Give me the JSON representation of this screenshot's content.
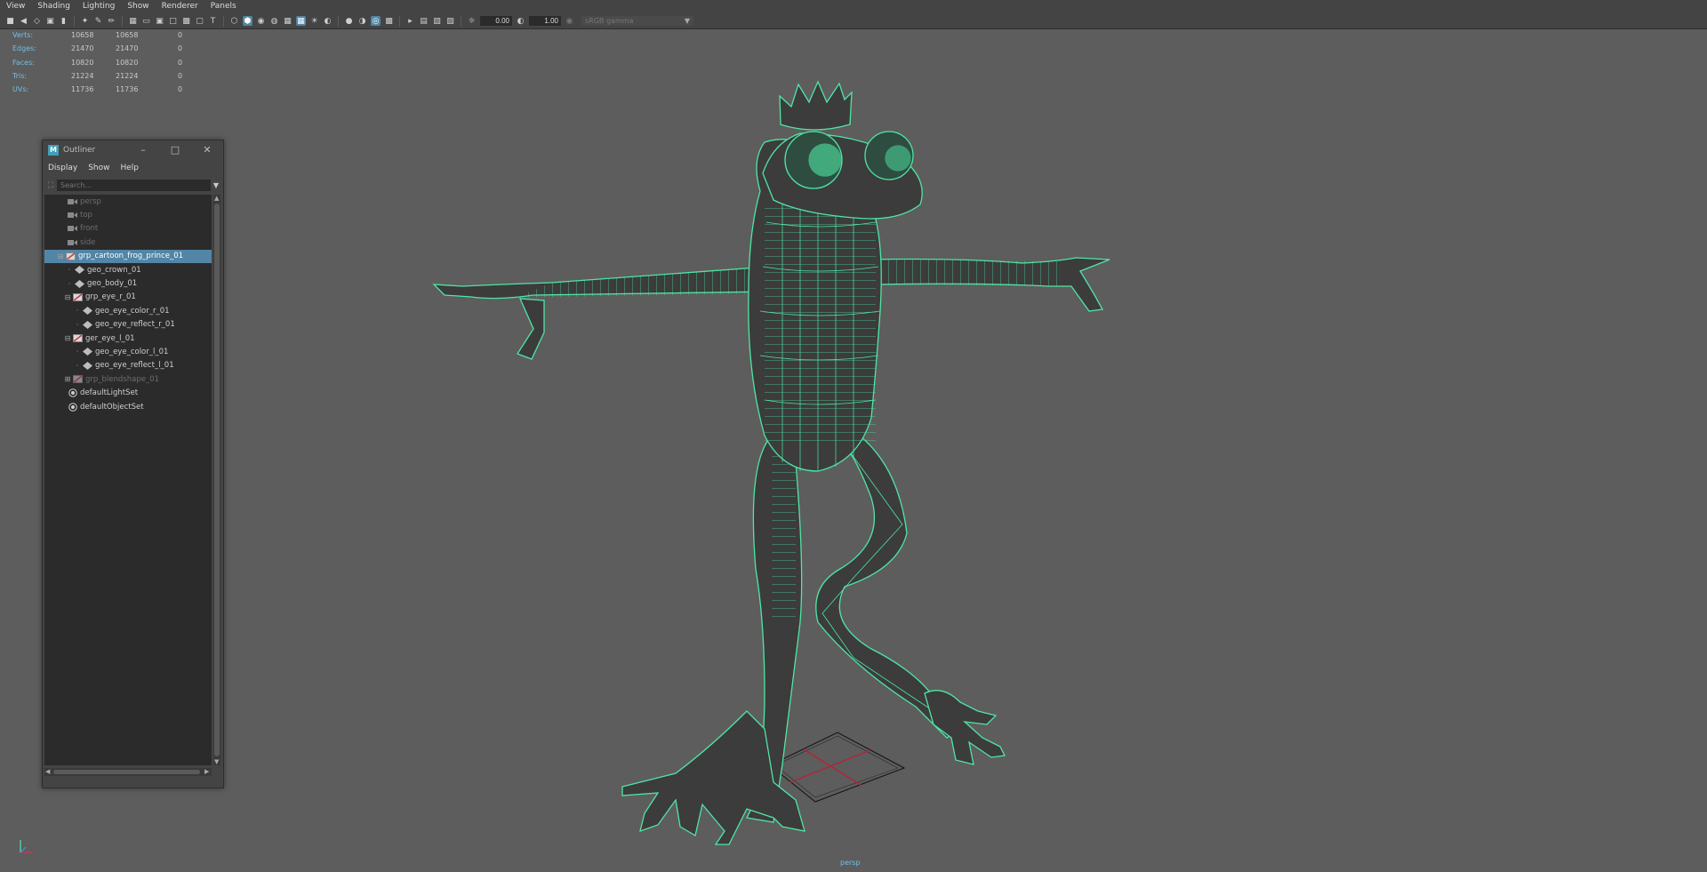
{
  "menubar": {
    "items": [
      "View",
      "Shading",
      "Lighting",
      "Show",
      "Renderer",
      "Panels"
    ]
  },
  "toolbar": {
    "exposure": "0.00",
    "gamma": "1.00",
    "color_space": "sRGB gamma"
  },
  "hud": {
    "rows": [
      {
        "label": "Verts:",
        "v1": "10658",
        "v2": "10658",
        "v3": "0"
      },
      {
        "label": "Edges:",
        "v1": "21470",
        "v2": "21470",
        "v3": "0"
      },
      {
        "label": "Faces:",
        "v1": "10820",
        "v2": "10820",
        "v3": "0"
      },
      {
        "label": "Tris:",
        "v1": "21224",
        "v2": "21224",
        "v3": "0"
      },
      {
        "label": "UVs:",
        "v1": "11736",
        "v2": "11736",
        "v3": "0"
      }
    ]
  },
  "viewport": {
    "camera_label": "persp",
    "wire_color": "#4fe6a5"
  },
  "outliner": {
    "title": "Outliner",
    "menu": [
      "Display",
      "Show",
      "Help"
    ],
    "search_placeholder": "Search...",
    "items": [
      {
        "label": "persp",
        "icon": "camera-icon",
        "state": "dim"
      },
      {
        "label": "top",
        "icon": "camera-icon",
        "state": "dim"
      },
      {
        "label": "front",
        "icon": "camera-icon",
        "state": "dim"
      },
      {
        "label": "side",
        "icon": "camera-icon",
        "state": "dim"
      },
      {
        "label": "grp_cartoon_frog_prince_01",
        "icon": "group-icon",
        "state": "selected"
      },
      {
        "label": "geo_crown_01",
        "icon": "mesh-icon",
        "state": "normal"
      },
      {
        "label": "geo_body_01",
        "icon": "mesh-icon",
        "state": "normal"
      },
      {
        "label": "grp_eye_r_01",
        "icon": "group-icon",
        "state": "normal"
      },
      {
        "label": "geo_eye_color_r_01",
        "icon": "mesh-icon",
        "state": "normal"
      },
      {
        "label": "geo_eye_reflect_r_01",
        "icon": "mesh-icon",
        "state": "normal"
      },
      {
        "label": "ger_eye_l_01",
        "icon": "group-icon",
        "state": "normal"
      },
      {
        "label": "geo_eye_color_l_01",
        "icon": "mesh-icon",
        "state": "normal"
      },
      {
        "label": "geo_eye_reflect_l_01",
        "icon": "mesh-icon",
        "state": "normal"
      },
      {
        "label": "grp_blendshape_01",
        "icon": "group-icon",
        "state": "dim"
      },
      {
        "label": "defaultLightSet",
        "icon": "set-icon",
        "state": "normal"
      },
      {
        "label": "defaultObjectSet",
        "icon": "set-icon",
        "state": "normal"
      }
    ]
  }
}
